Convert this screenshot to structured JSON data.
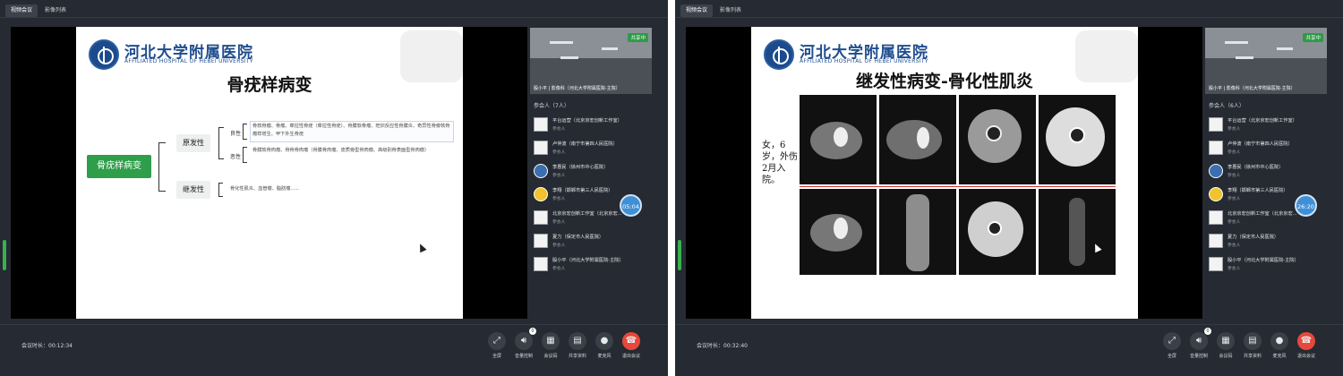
{
  "panels": [
    {
      "tabs": [
        "视频会议",
        "影像列表"
      ],
      "slide": {
        "hospital_name": "河北大学附属医院",
        "hospital_sub": "AFFILIATED HOSPITAL OF HEBEI UNIVERSITY",
        "title": "骨疣样病变",
        "main_label": "骨疣样病变",
        "branches": [
          {
            "label": "原发性",
            "items": [
              {
                "label": "良性",
                "detail": "骨软骨瘤、骨瘤、牵拉性骨疣（牵拉性骨疣）、骨膜软骨瘤、旺炽反应性骨膜炎、奇异性骨旁软骨瘤样增生、甲下外生骨疣"
              },
              {
                "label": "恶性",
                "detail": "骨膜软骨肉瘤、骨骨骨肉瘤（骨膜骨肉瘤、皮质旁型骨肉瘤、高级别骨表面型骨肉瘤）"
              }
            ]
          },
          {
            "label": "继发性",
            "items": [
              {
                "label": "",
                "detail": "骨化性肌炎、血管瘤、脂肪瘤......"
              }
            ]
          }
        ]
      },
      "video": {
        "status": "共享中",
        "name": "殷小平 | 影像科（河北大学附属医院-主院）"
      },
      "participants_header": "参会人（7人）",
      "participants": [
        {
          "name": "平台运营（北京京宏创新工作室）",
          "role": "参会人"
        },
        {
          "name": "卢仲波（南宁市第四人民医院）",
          "role": "参会人"
        },
        {
          "name": "李惠民（徐州市中心医院）",
          "role": "参会人"
        },
        {
          "name": "李翔（邯郸市第三人民医院）",
          "role": "参会人"
        },
        {
          "name": "北京京宏创新工作室（北京京宏...",
          "role": "参会人"
        },
        {
          "name": "夏力（保定市人民医院）",
          "role": "参会人"
        },
        {
          "name": "殷小平（河北大学附属医院-主院）",
          "role": "参会人"
        }
      ],
      "timer": "05:04",
      "duration_label": "会议时长：",
      "duration": "00:12:34"
    },
    {
      "tabs": [
        "视频会议",
        "影像列表"
      ],
      "slide": {
        "hospital_name": "河北大学附属医院",
        "hospital_sub": "AFFILIATED HOSPITAL OF HEBEI UNIVERSITY",
        "title": "继发性病变-骨化性肌炎",
        "note": "女，6岁，外伤2月入院。"
      },
      "video": {
        "status": "共享中",
        "name": "殷小平 | 影像科（河北大学附属医院-主院）"
      },
      "participants_header": "参会人（6人）",
      "participants": [
        {
          "name": "平台运营（北京京宏创新工作室）",
          "role": "参会人"
        },
        {
          "name": "卢仲波（南宁市第四人民医院）",
          "role": "参会人"
        },
        {
          "name": "李惠民（徐州市中心医院）",
          "role": "参会人"
        },
        {
          "name": "李翔（邯郸市第三人民医院）",
          "role": "参会人"
        },
        {
          "name": "北京京宏创新工作室（北京京宏...",
          "role": "参会人"
        },
        {
          "name": "夏力（保定市人民医院）",
          "role": "参会人"
        },
        {
          "name": "殷小平（河北大学附属医院-主院）",
          "role": "参会人"
        }
      ],
      "timer": "26:20",
      "duration_label": "会议时长：",
      "duration": "00:32:40"
    }
  ],
  "controls": [
    {
      "label": "全屏",
      "icon": "fullscreen-icon"
    },
    {
      "label": "音量控制",
      "icon": "volume-icon"
    },
    {
      "label": "会议码",
      "icon": "qrcode-icon"
    },
    {
      "label": "共享资料",
      "icon": "document-icon"
    },
    {
      "label": "麦克风",
      "icon": "microphone-icon"
    },
    {
      "label": "退出会议",
      "icon": "hangup-icon"
    }
  ],
  "volume_badge": "0"
}
